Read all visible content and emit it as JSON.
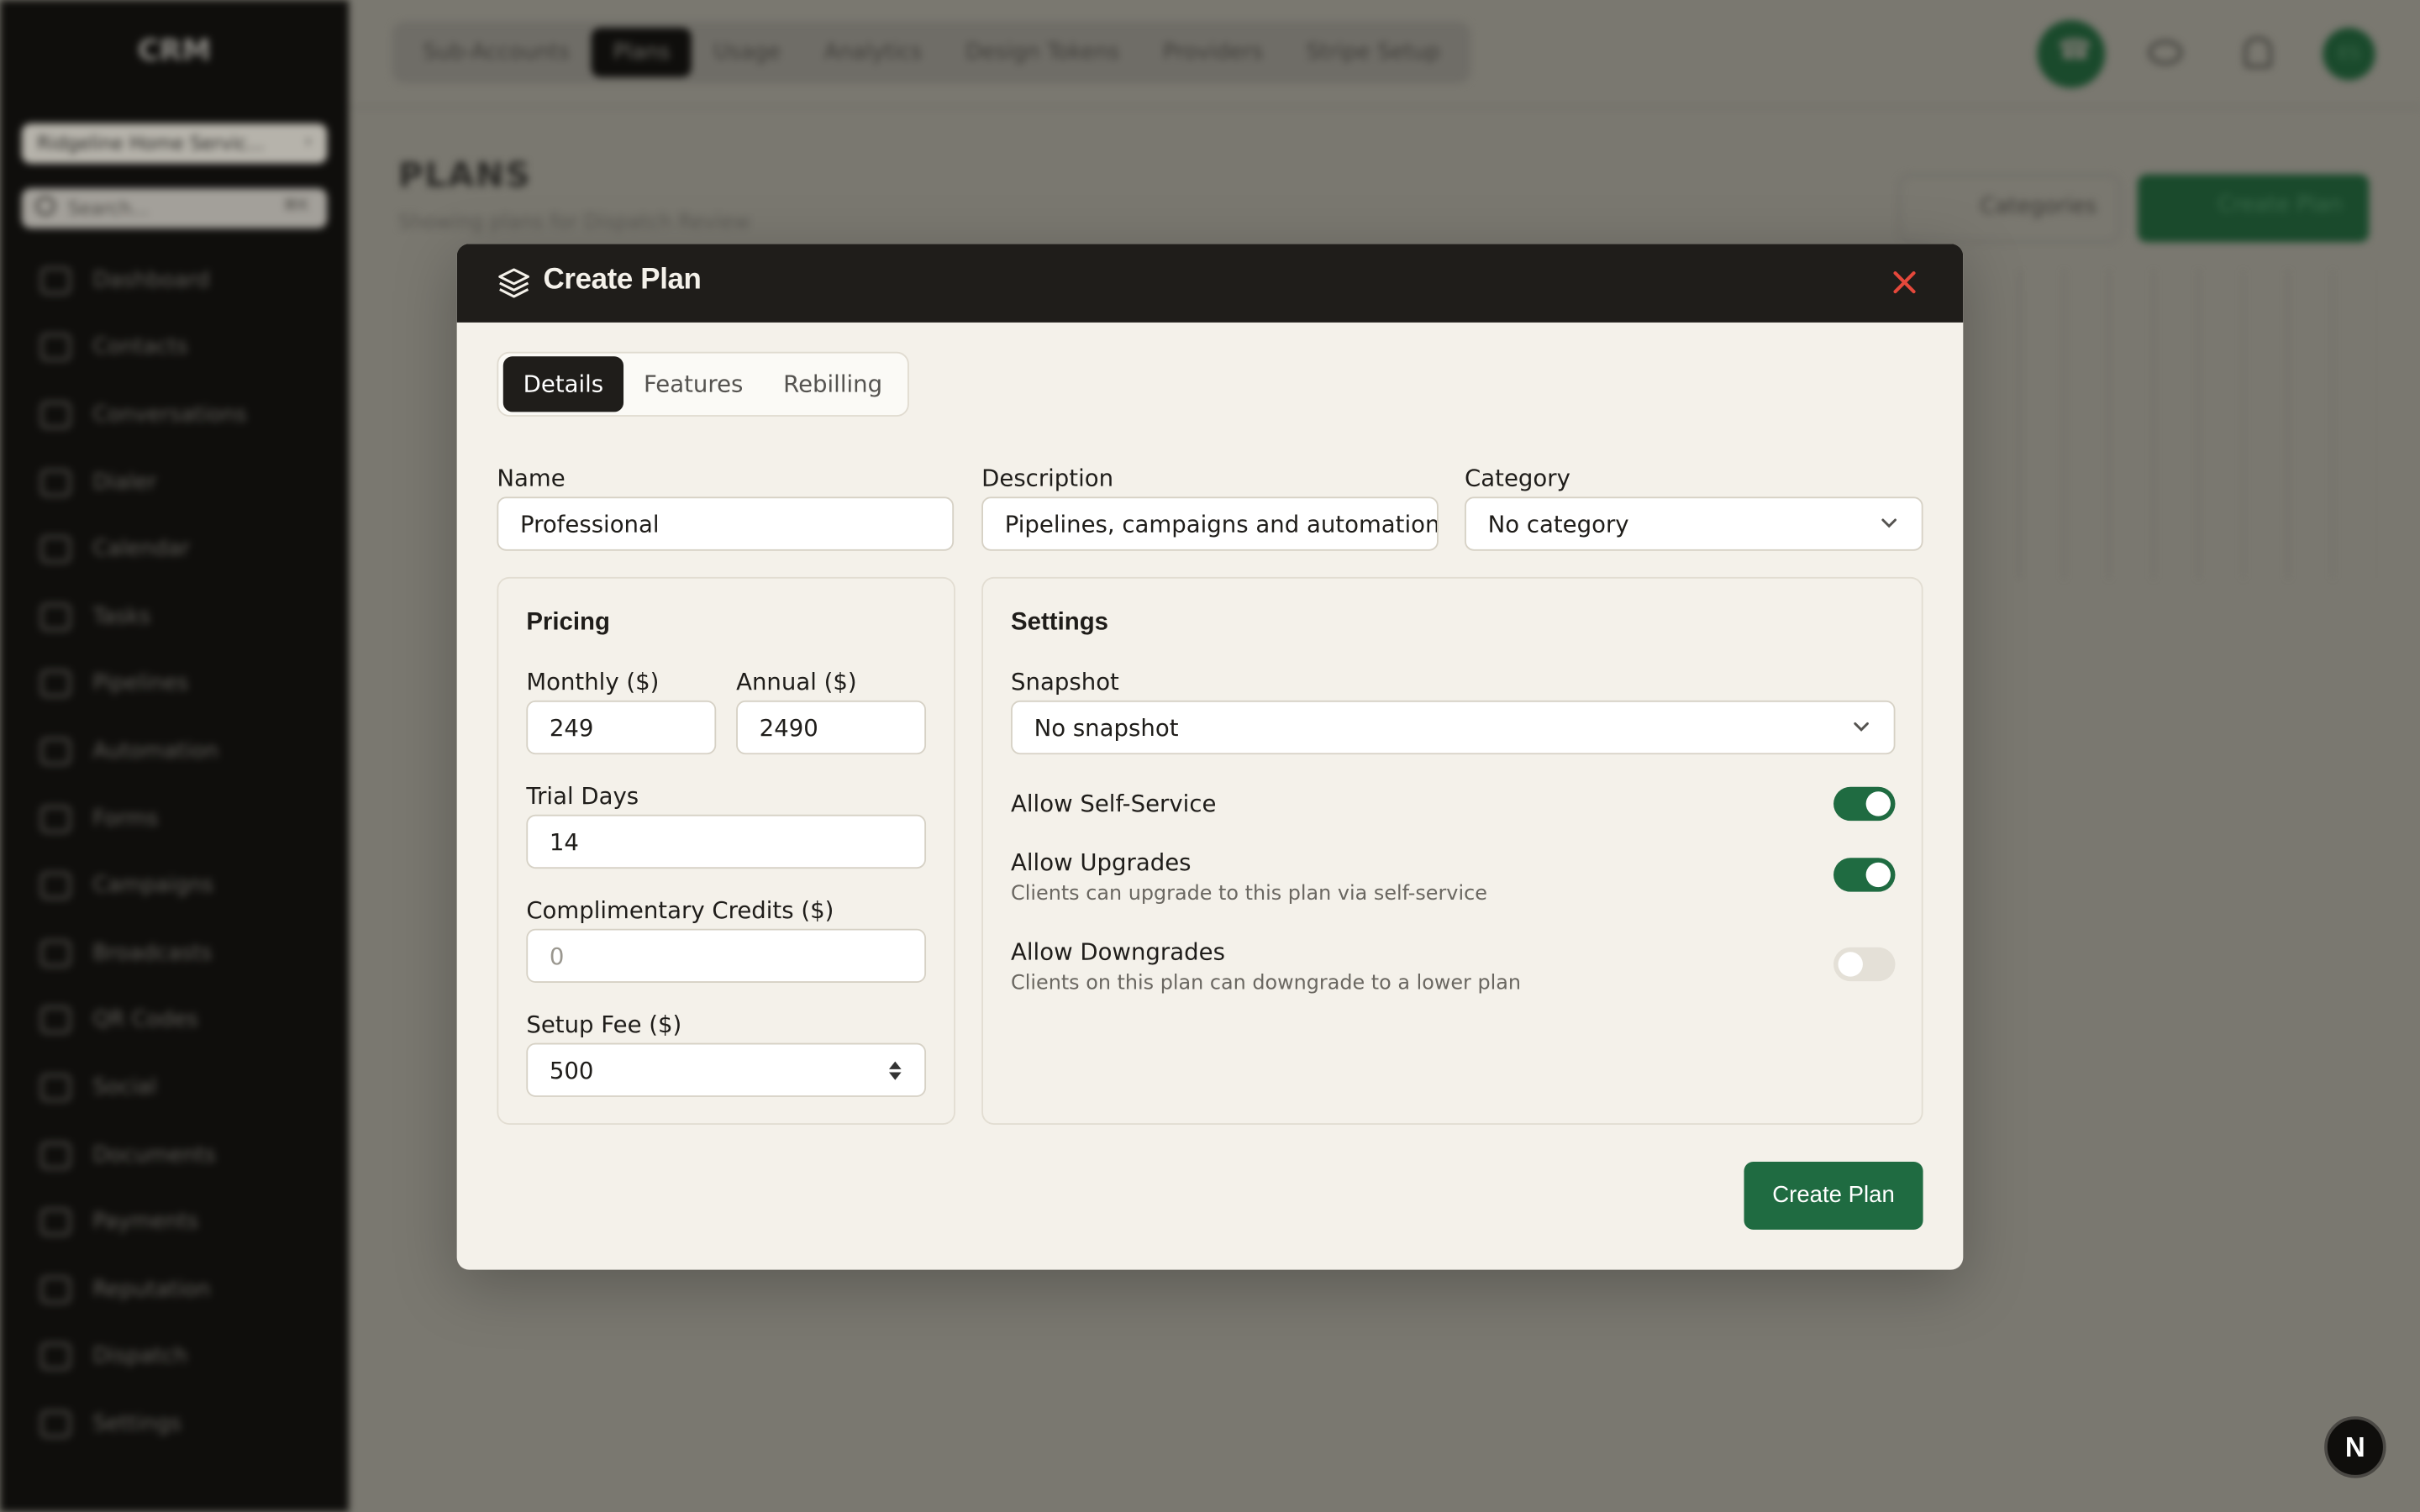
{
  "app": {
    "brand": "CRM",
    "account": "Ridgeline Home Servic...",
    "search_placeholder": "Search...",
    "search_shortcut": "⌘K",
    "nav": [
      "Dashboard",
      "Contacts",
      "Conversations",
      "Dialer",
      "Calendar",
      "Tasks",
      "Pipelines",
      "Automation",
      "Forms",
      "Campaigns",
      "Broadcasts",
      "QR Codes",
      "Social",
      "Documents",
      "Payments",
      "Reputation",
      "Dispatch",
      "Settings"
    ],
    "top_tabs": [
      "Sub-Accounts",
      "Plans",
      "Usage",
      "Analytics",
      "Design Tokens",
      "Providers",
      "Stripe Setup"
    ],
    "active_top_tab": "Plans",
    "avatar_initials": "ES",
    "page_title": "PLANS",
    "page_subtitle": "Showing plans for Dispatch Review",
    "categories_button": "Categories",
    "create_plan_button": "Create Plan",
    "fab_label": "N"
  },
  "modal": {
    "title": "Create Plan",
    "tabs": [
      "Details",
      "Features",
      "Rebilling"
    ],
    "active_tab": "Details",
    "name": {
      "label": "Name",
      "value": "Professional"
    },
    "description": {
      "label": "Description",
      "value": "Pipelines, campaigns and automation fo"
    },
    "category": {
      "label": "Category",
      "value": "No category"
    },
    "pricing": {
      "title": "Pricing",
      "monthly": {
        "label": "Monthly ($)",
        "value": "249"
      },
      "annual": {
        "label": "Annual ($)",
        "value": "2490"
      },
      "trial": {
        "label": "Trial Days",
        "value": "14"
      },
      "credits": {
        "label": "Complimentary Credits ($)",
        "placeholder": "0"
      },
      "setup": {
        "label": "Setup Fee ($)",
        "value": "500"
      }
    },
    "settings": {
      "title": "Settings",
      "snapshot": {
        "label": "Snapshot",
        "value": "No snapshot"
      },
      "self_service": {
        "label": "Allow Self-Service",
        "enabled": true
      },
      "upgrades": {
        "label": "Allow Upgrades",
        "desc": "Clients can upgrade to this plan via self-service",
        "enabled": true
      },
      "downgrades": {
        "label": "Allow Downgrades",
        "desc": "Clients on this plan can downgrade to a lower plan",
        "enabled": false
      }
    },
    "submit_label": "Create Plan",
    "colors": {
      "accent": "#1f6b41",
      "header": "#1f1d1a",
      "close": "#e5483b"
    }
  }
}
